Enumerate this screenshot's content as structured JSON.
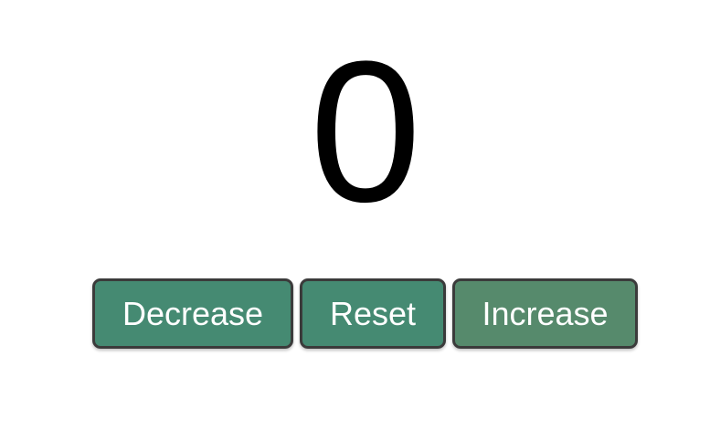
{
  "counter": {
    "value": "0"
  },
  "buttons": {
    "decrease": {
      "label": "Decrease",
      "color": "#458a72"
    },
    "reset": {
      "label": "Reset",
      "color": "#458a72"
    },
    "increase": {
      "label": "Increase",
      "color": "#568a6c"
    }
  }
}
